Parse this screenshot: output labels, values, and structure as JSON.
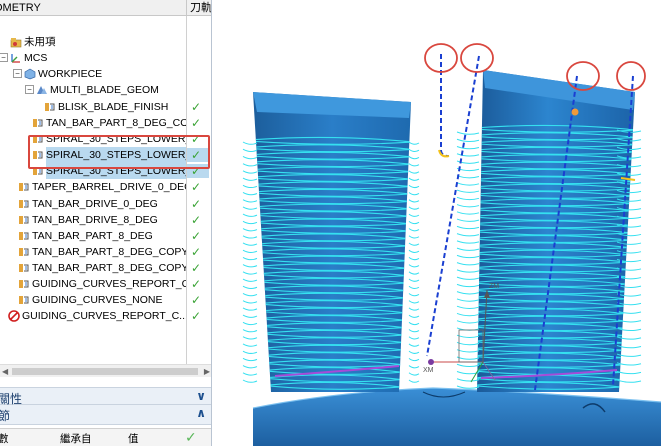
{
  "navigator": {
    "header_name": "OMETRY",
    "header_col": "刀軌",
    "items": [
      {
        "label": "OMETRY",
        "checked": false
      },
      {
        "label": "未用項",
        "checked": false
      },
      {
        "label": "MCS",
        "checked": false
      },
      {
        "label": "WORKPIECE",
        "checked": false
      },
      {
        "label": "MULTI_BLADE_GEOM",
        "checked": false
      },
      {
        "label": "BLISK_BLADE_FINISH",
        "checked": true
      },
      {
        "label": "TAN_BAR_PART_8_DEG_CO...",
        "checked": true
      },
      {
        "label": "SPIRAL_30_STEPS_LOWER_...",
        "checked": true
      },
      {
        "label": "SPIRAL_30_STEPS_LOWER_...",
        "checked": true
      },
      {
        "label": "SPIRAL_30_STEPS_LOWER_...",
        "checked": true
      },
      {
        "label": "TAPER_BARREL_DRIVE_0_DEG",
        "checked": true
      },
      {
        "label": "TAN_BAR_DRIVE_0_DEG",
        "checked": true
      },
      {
        "label": "TAN_BAR_DRIVE_8_DEG",
        "checked": true
      },
      {
        "label": "TAN_BAR_PART_8_DEG",
        "checked": true
      },
      {
        "label": "TAN_BAR_PART_8_DEG_COPY",
        "checked": true
      },
      {
        "label": "TAN_BAR_PART_8_DEG_COPY...",
        "checked": true
      },
      {
        "label": "GUIDING_CURVES_REPORT_C...",
        "checked": true
      },
      {
        "label": "GUIDING_CURVES_NONE",
        "checked": true
      },
      {
        "label": "GUIDING_CURVES_REPORT_C...",
        "checked": true
      }
    ]
  },
  "sections": {
    "properties": "關性",
    "details": "節"
  },
  "table": {
    "col1": "數",
    "col2": "繼承自",
    "col3": "值"
  },
  "colors": {
    "check": "#3aa335",
    "selection": "#b9d9ef",
    "highlight_box": "#d9473e",
    "blade": "#1f6fb5",
    "toolpath": "#35e0f0",
    "guide": "#1a3fd1",
    "hub": "#2a7bc7",
    "annotation_circle": "#d9473e"
  },
  "icons": [
    "mcs-icon",
    "workpiece-icon",
    "geometry-icon",
    "operation-icon",
    "check-icon",
    "error-icon"
  ]
}
